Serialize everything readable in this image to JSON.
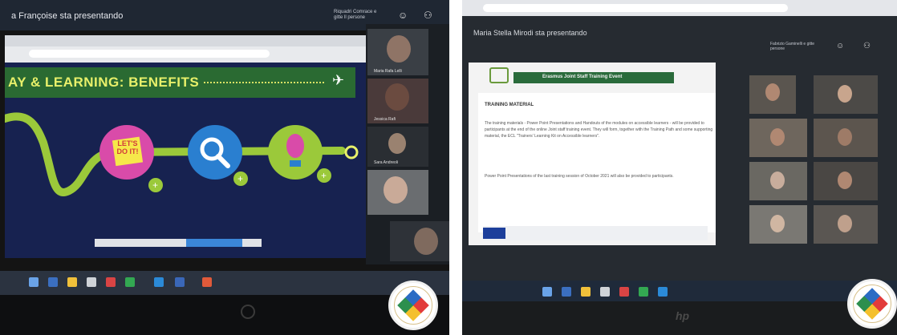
{
  "left": {
    "presenter": "a Françoise sta presentando",
    "meeting_meta": "Riquadri Comrace e gitte ll persone",
    "slide_title": "AY & LEARNING: BENEFITS",
    "sticky_note": "LET'S DO IT!",
    "participants": [
      "Maria Rafa Lelli",
      "Jessica Rafi",
      "Sara Andreoli",
      ""
    ],
    "taskbar_icons": 9
  },
  "right": {
    "presenter": "Maria Stella Mirodi sta presentando",
    "meeting_meta": "Fabrizio Gaminelli e gitte persone",
    "slide_header": "Erasmus Joint Staff Training Event",
    "slide_heading": "TRAINING MATERIAL",
    "slide_paragraph_1": "The training materials - Power Point Presentations and Handouts of the modules on accessible learners - will be provided to participants at the end of the online Joint staff training event. They will form, together with the Training Path and some supporting material, the ECL \"Trainers' Learning Kit on Accessible learners\".",
    "slide_paragraph_2": "Power Point Presentations of the last training session of October 2021 will also be provided to participants.",
    "hp_logo": "hp"
  },
  "colors": {
    "slide_banner": "#2a6a32",
    "slide_bg": "#172250",
    "title_yellow": "#e8f06a",
    "path_green": "#9bc93a",
    "magenta": "#d94ba9",
    "blue": "#2a7fd0"
  }
}
